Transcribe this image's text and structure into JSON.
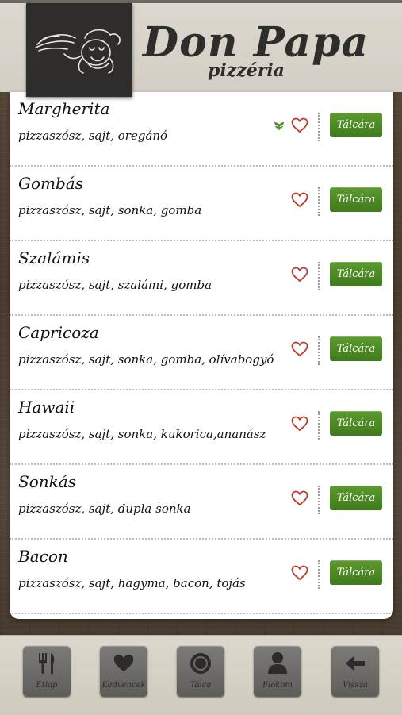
{
  "brand": {
    "title": "Don Papa",
    "subtitle": "pizzéria"
  },
  "icons": {
    "logo": "chef-mascot-logo",
    "vegetarian": "leaf-icon",
    "favorite": "heart-outline-icon"
  },
  "colors": {
    "accent_green": "#4a8a23",
    "heart_red": "#c0392b",
    "dark": "#2e2d2b"
  },
  "menu": {
    "items": [
      {
        "name": "Margherita",
        "desc": "pizzaszósz, sajt, oregánó",
        "vegetarian": true,
        "button": "Tálcára"
      },
      {
        "name": "Gombás",
        "desc": "pizzaszósz, sajt, sonka, gomba",
        "vegetarian": false,
        "button": "Tálcára"
      },
      {
        "name": "Szalámis",
        "desc": "pizzaszósz, sajt, szalámi, gomba",
        "vegetarian": false,
        "button": "Tálcára"
      },
      {
        "name": "Capricoza",
        "desc": "pizzaszósz, sajt, sonka, gomba, olívabogyó",
        "vegetarian": false,
        "button": "Tálcára"
      },
      {
        "name": "Hawaii",
        "desc": "pizzaszósz, sajt, sonka, kukorica,ananász",
        "vegetarian": false,
        "button": "Tálcára"
      },
      {
        "name": "Sonkás",
        "desc": "pizzaszósz, sajt, dupla sonka",
        "vegetarian": false,
        "button": "Tálcára"
      },
      {
        "name": "Bacon",
        "desc": "pizzaszósz, sajt, hagyma, bacon, tojás",
        "vegetarian": false,
        "button": "Tálcára"
      }
    ]
  },
  "nav": {
    "menu_label": "Étlap",
    "favorites_label": "Kedvencek",
    "tray_label": "Tálca",
    "account_label": "Fiókom",
    "back_label": "Vissza"
  }
}
